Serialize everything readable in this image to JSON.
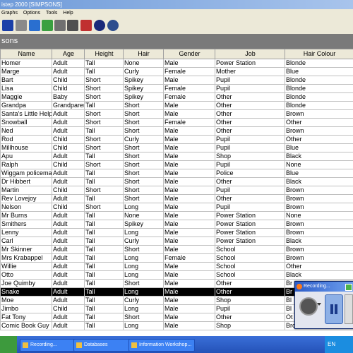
{
  "window": {
    "title": "istep 2000 [SIMPSONS]"
  },
  "menu": [
    "Graphs",
    "Options",
    "Tools",
    "Help"
  ],
  "toolbar": [
    "save-icon",
    "print-icon",
    "edit-icon",
    "add-icon",
    "link-icon",
    "view-icon",
    "chart-icon",
    "info-icon",
    "globe-icon"
  ],
  "section_title": "sons",
  "table": {
    "columns": [
      "Name",
      "Age",
      "Height",
      "Hair",
      "Gender",
      "Job",
      "Hair Colour"
    ],
    "rows": [
      [
        "Homer",
        "Adult",
        "Tall",
        "None",
        "Male",
        "Power Station",
        "Blonde"
      ],
      [
        "Marge",
        "Adult",
        "Tall",
        "Curly",
        "Female",
        "Mother",
        "Blue"
      ],
      [
        "Bart",
        "Child",
        "Short",
        "Spikey",
        "Male",
        "Pupil",
        "Blonde"
      ],
      [
        "Lisa",
        "Child",
        "Short",
        "Spikey",
        "Female",
        "Pupil",
        "Blonde"
      ],
      [
        "Maggie",
        "Baby",
        "Short",
        "Spikey",
        "Female",
        "Other",
        "Blonde"
      ],
      [
        "Grandpa",
        "Grandparent",
        "Tall",
        "Short",
        "Male",
        "Other",
        "Blonde"
      ],
      [
        "Santa's Little Helper",
        "Adult",
        "Short",
        "Short",
        "Male",
        "Other",
        "Brown"
      ],
      [
        "Snowball",
        "Adult",
        "Short",
        "Short",
        "Female",
        "Other",
        "Other"
      ],
      [
        "Ned",
        "Adult",
        "Tall",
        "Short",
        "Male",
        "Other",
        "Brown"
      ],
      [
        "Rod",
        "Child",
        "Short",
        "Curly",
        "Male",
        "Pupil",
        "Other"
      ],
      [
        "Millhouse",
        "Child",
        "Short",
        "Short",
        "Male",
        "Pupil",
        "Blue"
      ],
      [
        "Apu",
        "Adult",
        "Tall",
        "Short",
        "Male",
        "Shop",
        "Black"
      ],
      [
        "Ralph",
        "Child",
        "Short",
        "Short",
        "Male",
        "Pupil",
        "None"
      ],
      [
        "Wiggam policeman",
        "Adult",
        "Tall",
        "Short",
        "Male",
        "Police",
        "Blue"
      ],
      [
        "Dr Hibbert",
        "Adult",
        "Tall",
        "Short",
        "Male",
        "Other",
        "Black"
      ],
      [
        "Martin",
        "Child",
        "Short",
        "Short",
        "Male",
        "Pupil",
        "Brown"
      ],
      [
        "Rev Lovejoy",
        "Adult",
        "Tall",
        "Short",
        "Male",
        "Other",
        "Brown"
      ],
      [
        "Nelson",
        "Child",
        "Short",
        "Long",
        "Male",
        "Pupil",
        "Brown"
      ],
      [
        "Mr Burns",
        "Adult",
        "Tall",
        "None",
        "Male",
        "Power Station",
        "None"
      ],
      [
        "Smithers",
        "Adult",
        "Tall",
        "Spikey",
        "Male",
        "Power Station",
        "Brown"
      ],
      [
        "Lenny",
        "Adult",
        "Tall",
        "Long",
        "Male",
        "Power Station",
        "Brown"
      ],
      [
        "Carl",
        "Adult",
        "Tall",
        "Curly",
        "Male",
        "Power Station",
        "Black"
      ],
      [
        "Mr Skinner",
        "Adult",
        "Tall",
        "Short",
        "Male",
        "School",
        "Brown"
      ],
      [
        "Mrs Krabappel",
        "Adult",
        "Tall",
        "Long",
        "Female",
        "School",
        "Brown"
      ],
      [
        "Willie",
        "Adult",
        "Tall",
        "Long",
        "Male",
        "School",
        "Other"
      ],
      [
        "Otto",
        "Adult",
        "Tall",
        "Long",
        "Male",
        "School",
        "Black"
      ],
      [
        "Joe Quimby",
        "Adult",
        "Tall",
        "Short",
        "Male",
        "Other",
        "Br"
      ],
      [
        "Snake",
        "Adult",
        "Tall",
        "Long",
        "Male",
        "Other",
        "Br"
      ],
      [
        "Moe",
        "Adult",
        "Tall",
        "Curly",
        "Male",
        "Shop",
        "Bl"
      ],
      [
        "Jimbo",
        "Child",
        "Tall",
        "Long",
        "Male",
        "Pupil",
        "Bl"
      ],
      [
        "Fat Tony",
        "Adult",
        "Tall",
        "Short",
        "Male",
        "Other",
        "Ot"
      ],
      [
        "Comic Book Guy",
        "Adult",
        "Tall",
        "Long",
        "Male",
        "Shop",
        "Brown"
      ]
    ],
    "selected_row": 27
  },
  "recording_window": {
    "title": "Recording..."
  },
  "taskbar": {
    "tasks": [
      "Recording...",
      "Databases",
      "Information Workshop..."
    ],
    "tray": "EN"
  },
  "colors": {
    "selection": "#000000",
    "taskbar": "#2452b8",
    "header_strip": "#7a7a7a"
  }
}
